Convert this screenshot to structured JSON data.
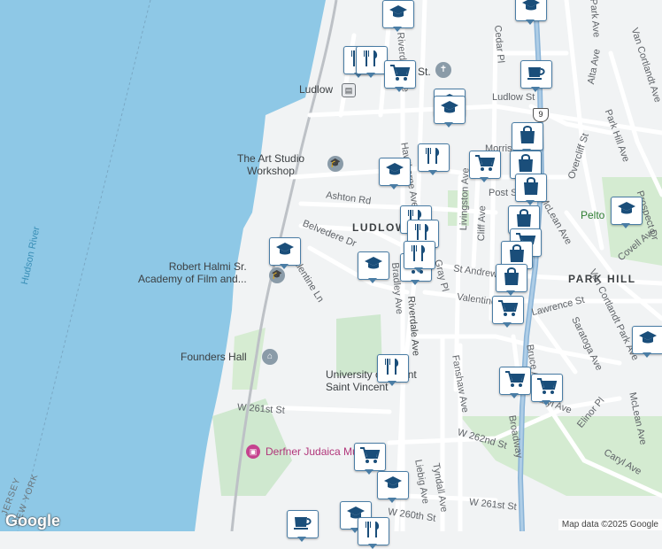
{
  "map": {
    "water_label": "Hudson River",
    "state_labels": [
      "JERSEY",
      "NEW YORK"
    ],
    "neighborhoods": [
      "LUDLOW",
      "PARK HILL"
    ],
    "places": [
      {
        "id": "art-studio",
        "text": "The Art Studio\nWorkshop",
        "icon": "school-icon"
      },
      {
        "id": "robert-halmi",
        "text": "Robert Halmi Sr.\nAcademy of Film and...",
        "icon": "school-icon"
      },
      {
        "id": "founders-hall",
        "text": "Founders Hall",
        "icon": "landmark-icon"
      },
      {
        "id": "mount-saint-vincent",
        "text": "University of Mount\nSaint Vincent",
        "icon": "school-icon"
      },
      {
        "id": "derfner",
        "text": "Derfner Judaica Museum",
        "icon": "museum-icon"
      },
      {
        "id": "pelton",
        "text": "Pelto",
        "icon": "park-icon"
      },
      {
        "id": "ludlow-station",
        "text": "Ludlow",
        "icon": "train-icon"
      },
      {
        "id": "st-church",
        "text": "St.",
        "icon": "church-icon"
      }
    ],
    "streets": [
      "Ashton Rd",
      "Belvedere Dr",
      "Valentine Ln",
      "Ludlow St",
      "Livingston Ave",
      "Cliff Ave",
      "Cedar Pl",
      "Alta Ave",
      "Overcliff St",
      "Park Hill Ave",
      "Prospect Dr",
      "Covell Ave",
      "Van Cortlandt Park Ave",
      "Saratoga Ave",
      "Elinor Pl",
      "Caryl Ave",
      "Broadway",
      "W 262nd St",
      "W 261st St",
      "W 260th St",
      "Fanshaw Ave",
      "Bruce Ave",
      "Liebig Ave",
      "Tyndall Ave",
      "Riverdale Ave",
      "Gray Pl",
      "St Andrews Pl",
      "Valentine Ave",
      "Lawrence St",
      "Hawthorne Ave",
      "McLean Ave",
      "Morris St",
      "Post St",
      "W 261st St",
      "Caryl Ave",
      "McLean Ave",
      "Van Cortlandt Ave",
      "Park Ave",
      "Bradley Ave",
      "Riverdale Ave"
    ],
    "route_shield": "9",
    "attribution": "Map data ©2025 Google",
    "logo": "Google"
  },
  "colors": {
    "water": "#8ec8e6",
    "land": "#f1f3f4",
    "park": "#c8e6c9",
    "road": "#ffffff",
    "highway": "#8ab4d8",
    "pin_border": "#4a7da5",
    "pin_icon": "#1a4e7a"
  },
  "pins": [
    {
      "type": "school-pin",
      "icon": "graduation-cap-icon"
    },
    {
      "type": "restaurant-pin",
      "icon": "fork-knife-icon"
    },
    {
      "type": "shopping-cart-pin",
      "icon": "cart-icon"
    },
    {
      "type": "cafe-pin",
      "icon": "coffee-cup-icon"
    },
    {
      "type": "shopping-bag-pin",
      "icon": "bag-icon"
    }
  ]
}
